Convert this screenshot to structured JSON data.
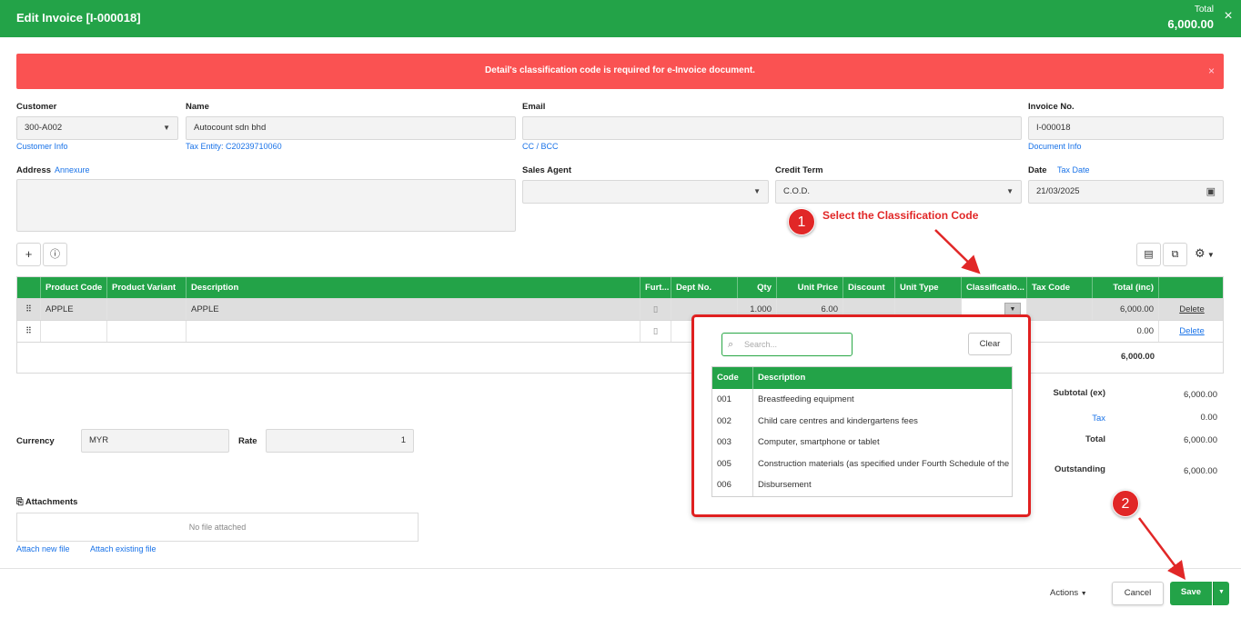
{
  "header": {
    "title": "Edit Invoice [I-000018]",
    "total_label": "Total",
    "total_value": "6,000.00",
    "close": "×"
  },
  "banner": {
    "message": "Detail's classification code is required for e-Invoice document.",
    "close": "×"
  },
  "customer": {
    "label": "Customer",
    "value": "300-A002",
    "link": "Customer Info"
  },
  "name": {
    "label": "Name",
    "value": "Autocount sdn bhd",
    "link": "Tax Entity: C20239710060"
  },
  "email": {
    "label": "Email",
    "value": "",
    "link": "CC / BCC"
  },
  "invoice_no": {
    "label": "Invoice No.",
    "value": "I-000018",
    "link": "Document Info"
  },
  "address": {
    "label": "Address",
    "link": "Annexure",
    "value": ""
  },
  "sales_agent": {
    "label": "Sales Agent",
    "value": ""
  },
  "credit_term": {
    "label": "Credit Term",
    "value": "C.O.D."
  },
  "date": {
    "label": "Date",
    "link": "Tax Date",
    "value": "21/03/2025"
  },
  "table": {
    "headers": [
      "Product Code",
      "Product Variant",
      "Description",
      "Furt...",
      "Dept No.",
      "Qty",
      "Unit Price",
      "Discount",
      "Unit Type",
      "Classificatio...",
      "Tax Code",
      "Total (inc)"
    ],
    "rows": [
      {
        "product_code": "APPLE",
        "variant": "",
        "description": "APPLE",
        "qty": "1.000",
        "unit_price": "6.00",
        "total": "6,000.00",
        "action": "Delete"
      },
      {
        "product_code": "",
        "variant": "",
        "description": "",
        "qty": "",
        "unit_price": "",
        "total": "0.00",
        "action": "Delete"
      }
    ],
    "grand_total": "6,000.00"
  },
  "popup": {
    "search_placeholder": "Search...",
    "clear_label": "Clear",
    "col_code": "Code",
    "col_description": "Description",
    "items": [
      {
        "code": "001",
        "description": "Breastfeeding equipment"
      },
      {
        "code": "002",
        "description": "Child care centres and kindergartens fees"
      },
      {
        "code": "003",
        "description": "Computer, smartphone or tablet"
      },
      {
        "code": "005",
        "description": "Construction materials (as specified under Fourth Schedule of the L"
      },
      {
        "code": "006",
        "description": "Disbursement"
      }
    ]
  },
  "annotations": {
    "step1_number": "1",
    "step1_text": "Select the Classification Code",
    "step2_number": "2"
  },
  "summary": {
    "subtotal_label": "Subtotal (ex)",
    "subtotal_value": "6,000.00",
    "tax_label": "Tax",
    "tax_value": "0.00",
    "total_label": "Total",
    "total_value": "6,000.00",
    "outstanding_label": "Outstanding",
    "outstanding_value": "6,000.00"
  },
  "currency": {
    "label": "Currency",
    "value": "MYR",
    "rate_label": "Rate",
    "rate_value": "1"
  },
  "attachments": {
    "label": "Attachments",
    "empty": "No file attached",
    "attach_new": "Attach new file",
    "attach_existing": "Attach existing file"
  },
  "footer": {
    "actions": "Actions",
    "cancel": "Cancel",
    "save": "Save"
  },
  "colors": {
    "brand": "#23a348",
    "error": "#fa5252",
    "annotation": "#e12727"
  }
}
